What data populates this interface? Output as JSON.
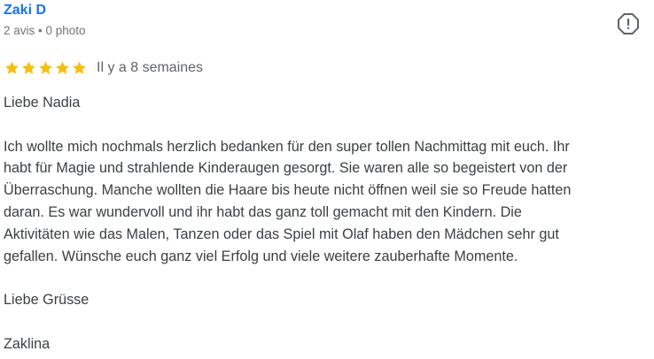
{
  "reviewer": {
    "name": "Zaki D",
    "meta": "2 avis • 0 photo"
  },
  "flag": {
    "icon": "report-flag-icon"
  },
  "rating": {
    "stars": 5,
    "max": 5,
    "star_color": "#fbbc04",
    "time_ago": "Il y a 8 semaines"
  },
  "review": {
    "greeting": "Liebe Nadia",
    "body_lines": [
      "Ich wollte mich nochmals herzlich bedanken für den super tollen Nachmittag mit euch. Ihr",
      "habt für Magie und strahlende Kinderaugen gesorgt. Sie waren alle so begeistert von der",
      "Überraschung. Manche wollten die Haare bis heute nicht öffnen weil sie so Freude hatten",
      "daran. Es war wundervoll und ihr habt das ganz toll gemacht mit den Kindern. Die",
      "Aktivitäten wie das Malen, Tanzen oder das Spiel mit Olaf haben den Mädchen sehr gut",
      "gefallen. Wünsche euch ganz viel Erfolg und viele weitere zauberhafte Momente."
    ],
    "closing": "Liebe Grüsse",
    "signature": "Zaklina"
  },
  "colors": {
    "name_link": "#1a73e8",
    "meta_text": "#70757a",
    "body_text": "#3c4043"
  }
}
